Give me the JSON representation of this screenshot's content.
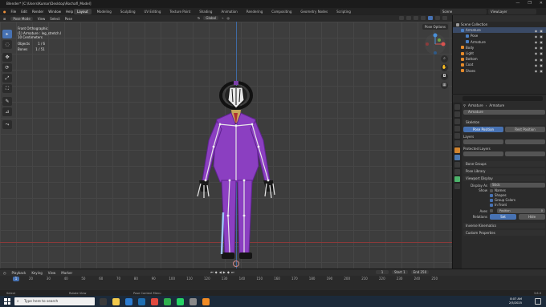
{
  "window": {
    "title": "Blender* [C:\\Users\\Kumar\\Desktop\\Rochafl_Model]",
    "controls": [
      "—",
      "❐",
      "✕"
    ]
  },
  "menubar": {
    "items": [
      "File",
      "Edit",
      "Render",
      "Window",
      "Help"
    ],
    "tabs": [
      "Layout",
      "Modeling",
      "Sculpting",
      "UV Editing",
      "Texture Paint",
      "Shading",
      "Animation",
      "Rendering",
      "Compositing",
      "Geometry Nodes",
      "Scripting"
    ],
    "active_tab": "Layout",
    "scene": "Scene",
    "view_layer": "ViewLayer"
  },
  "viewport_header": {
    "mode": "Pose Mode",
    "menus": [
      "View",
      "Select",
      "Pose"
    ],
    "orientation": "Global",
    "pose_options": "Pose Options"
  },
  "viewport_info": {
    "line1": "Front Orthographic",
    "line2": "(1) Armature : leg_stretch.l",
    "line3": "10 Centimeters",
    "objects_label": "Objects",
    "objects_value": "1 / 6",
    "bones_label": "Bones",
    "bones_value": "1 / 51"
  },
  "toolbar": [
    "▸",
    "◌",
    "✥",
    "⟳",
    "⤢",
    "⛶",
    "✎",
    "⊿",
    "⤳"
  ],
  "outliner": {
    "header": "Scene Collection",
    "rows": [
      {
        "label": "Scene Collection",
        "color": "#9a9a9a",
        "indent": 0,
        "selected": false
      },
      {
        "label": "Armature",
        "color": "#4a7fc4",
        "indent": 1,
        "selected": true
      },
      {
        "label": "Pose",
        "color": "#4a7fc4",
        "indent": 2,
        "selected": false
      },
      {
        "label": "Armature",
        "color": "#4a7fc4",
        "indent": 2,
        "selected": false
      },
      {
        "label": "Body",
        "color": "#e58a2a",
        "indent": 1,
        "selected": false
      },
      {
        "label": "Light",
        "color": "#e58a2a",
        "indent": 1,
        "selected": false
      },
      {
        "label": "Bottom",
        "color": "#e58a2a",
        "indent": 1,
        "selected": false
      },
      {
        "label": "Coat",
        "color": "#e58a2a",
        "indent": 1,
        "selected": false
      },
      {
        "label": "Shoes",
        "color": "#e58a2a",
        "indent": 1,
        "selected": false
      }
    ]
  },
  "properties": {
    "breadcrumb_a": "Armature",
    "breadcrumb_b": "Armature",
    "name_field": "Armature",
    "skeleton": "Skeleton",
    "pose_position": "Pose Position",
    "rest_position": "Rest Position",
    "layers": "Layers",
    "protected_layers": "Protected Layers",
    "bone_groups": "Bone Groups",
    "pose_library": "Pose Library",
    "viewport_display": "Viewport Display",
    "display_as_label": "Display As",
    "display_as_value": "Stick",
    "show_label": "Show",
    "show_options": [
      {
        "label": "Names",
        "checked": false
      },
      {
        "label": "Shapes",
        "checked": true
      },
      {
        "label": "Group Colors",
        "checked": true
      },
      {
        "label": "In Front",
        "checked": true
      }
    ],
    "axes_label": "Axes",
    "axes_position": "Position",
    "axes_value": "0",
    "relations_label": "Relations",
    "relations_set": "Set",
    "relations_hide": "Hide",
    "inverse_kinematics": "Inverse Kinematics",
    "custom_properties": "Custom Properties"
  },
  "timeline": {
    "menus": [
      "Playback",
      "Keying",
      "View",
      "Marker"
    ],
    "current_frame": "1",
    "start_label": "Start",
    "start_value": "1",
    "end_label": "End",
    "end_value": "250",
    "frame_box": "1",
    "ticks": [
      "20",
      "30",
      "40",
      "50",
      "60",
      "70",
      "80",
      "90",
      "100",
      "110",
      "120",
      "130",
      "140",
      "150",
      "160",
      "170",
      "180",
      "190",
      "200",
      "210",
      "220",
      "230",
      "240",
      "250"
    ]
  },
  "statusbar": {
    "select": "Select",
    "rotate": "Rotate View",
    "context": "Pose Context Menu",
    "version": "3.6.0"
  },
  "taskbar": {
    "search_placeholder": "Type here to search",
    "time": "8:07 AM",
    "date": "2/5/2025",
    "app_icon_colors": [
      "#3a3a3a",
      "#f2c94c",
      "#2d7dd2",
      "#1f6fb2",
      "#e04a3f",
      "#2fb14f",
      "#25d366",
      "#8a8a8a",
      "#f08a24"
    ]
  }
}
